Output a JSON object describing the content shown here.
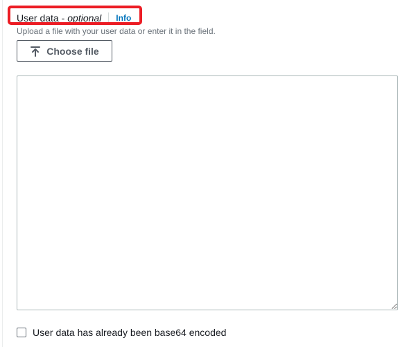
{
  "field": {
    "label": "User data -",
    "optional_label": "optional",
    "info_link": "Info",
    "description": "Upload a file with your user data or enter it in the field."
  },
  "upload": {
    "button_label": "Choose file",
    "icon": "upload-icon"
  },
  "textarea": {
    "value": "",
    "placeholder": ""
  },
  "checkbox": {
    "label": "User data has already been base64 encoded",
    "checked": false
  },
  "colors": {
    "highlight": "#ec1c24",
    "link": "#0073bb",
    "text": "#16191f",
    "muted": "#687078"
  }
}
